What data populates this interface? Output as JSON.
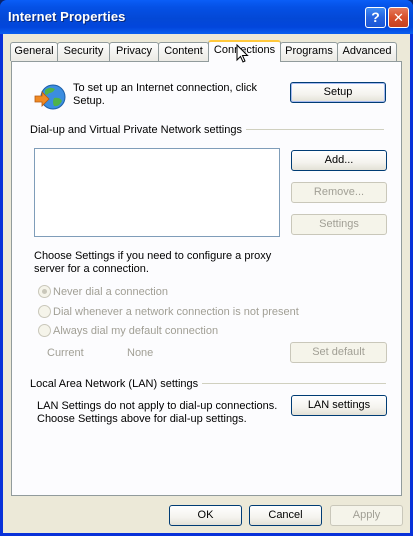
{
  "window": {
    "title": "Internet Properties",
    "help_glyph": "?",
    "close_glyph": "✕"
  },
  "tabs": [
    {
      "label": "General"
    },
    {
      "label": "Security"
    },
    {
      "label": "Privacy"
    },
    {
      "label": "Content"
    },
    {
      "label": "Connections",
      "active": true
    },
    {
      "label": "Programs"
    },
    {
      "label": "Advanced"
    }
  ],
  "setup": {
    "text": "To set up an Internet connection, click Setup.",
    "button": "Setup"
  },
  "dialup": {
    "group_label": "Dial-up and Virtual Private Network settings",
    "buttons": {
      "add": "Add...",
      "remove": "Remove...",
      "settings": "Settings"
    },
    "proxy_text": "Choose Settings if you need to configure a proxy server for a connection.",
    "options": [
      {
        "label": "Never dial a connection",
        "checked": true
      },
      {
        "label": "Dial whenever a network connection is not present",
        "checked": false
      },
      {
        "label": "Always dial my default connection",
        "checked": false
      }
    ],
    "current_label": "Current",
    "current_value": "None",
    "set_default": "Set default"
  },
  "lan": {
    "group_label": "Local Area Network (LAN) settings",
    "text": "LAN Settings do not apply to dial-up connections. Choose Settings above for dial-up settings.",
    "button": "LAN settings"
  },
  "footer": {
    "ok": "OK",
    "cancel": "Cancel",
    "apply": "Apply"
  },
  "icons": {
    "globe": "globe-network-icon",
    "cursor": "mouse-cursor-icon"
  },
  "colors": {
    "titlebar": "#0348d6",
    "face": "#ece9d8",
    "tab_highlight": "#ffc83c",
    "disabled_text": "#a19f95"
  }
}
